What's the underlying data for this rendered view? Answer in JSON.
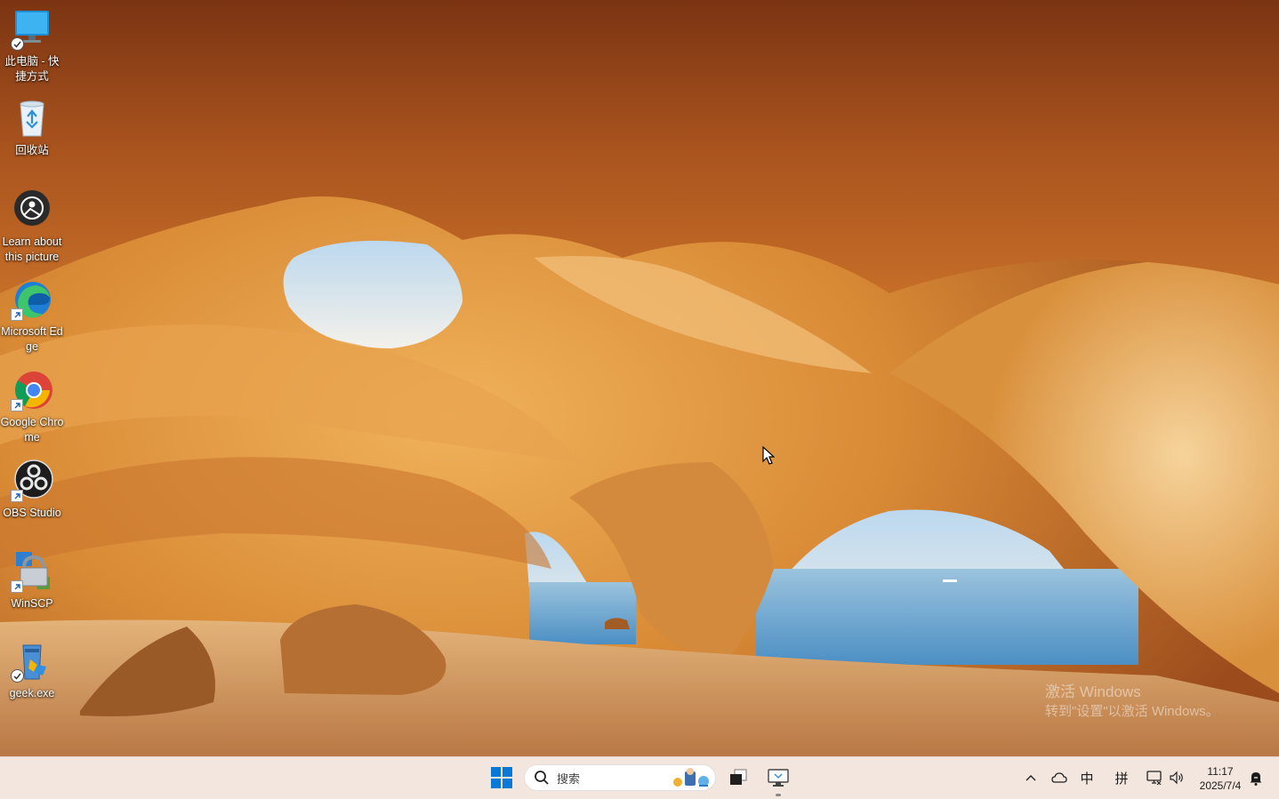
{
  "desktop": {
    "icons": [
      {
        "label": "此电脑 - 快捷方式",
        "icon": "computer-icon"
      },
      {
        "label": "回收站",
        "icon": "recycle-bin-icon"
      },
      {
        "label": "Learn about this picture",
        "icon": "learn-about-picture-icon"
      },
      {
        "label": "Microsoft Edge",
        "icon": "edge-icon"
      },
      {
        "label": "Google Chrome",
        "icon": "chrome-icon"
      },
      {
        "label": "OBS Studio",
        "icon": "obs-icon"
      },
      {
        "label": "WinSCP",
        "icon": "winscp-icon"
      },
      {
        "label": "geek.exe",
        "icon": "geek-icon"
      }
    ],
    "watermark": {
      "title": "激活 Windows",
      "subtitle": "转到\"设置\"以激活 Windows。"
    }
  },
  "taskbar": {
    "search_placeholder": "搜索",
    "tray": {
      "ime_lang": "中",
      "ime_mode": "拼"
    },
    "clock": {
      "time": "11:17",
      "date": "2025/7/4"
    }
  },
  "colors": {
    "taskbar_bg": "#f3e6de",
    "start_blue": "#0078d4"
  }
}
